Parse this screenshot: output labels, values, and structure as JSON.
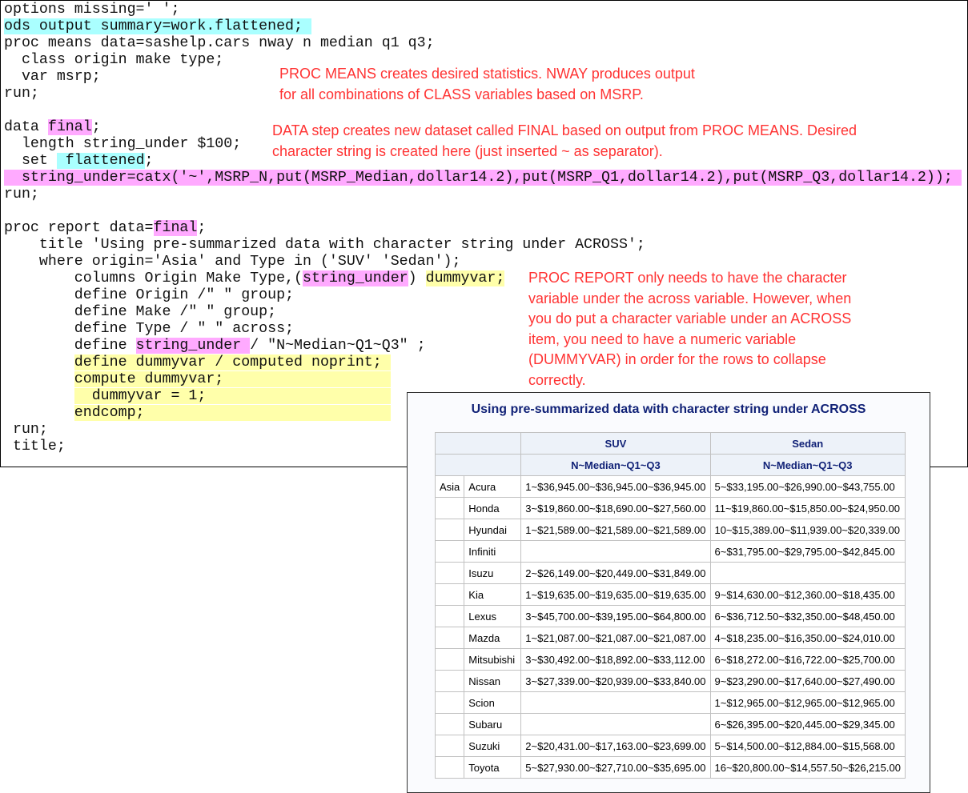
{
  "code_lines": [
    {
      "pre": "options missing=' ';",
      "hl": "",
      "post": ""
    },
    {
      "pre": "",
      "hl": "ods output summary=work.flattened; ",
      "post": "",
      "c": "hl-c"
    },
    {
      "pre": "proc means data=sashelp.cars nway n median q1 q3;",
      "hl": "",
      "post": ""
    },
    {
      "pre": "  class origin make type;",
      "hl": "",
      "post": ""
    },
    {
      "pre": "  var msrp;",
      "hl": "",
      "post": ""
    },
    {
      "pre": "run;",
      "hl": "",
      "post": ""
    },
    {
      "pre": "",
      "hl": "",
      "post": ""
    },
    {
      "pre": "data ",
      "hl": "final",
      "post": ";",
      "c": "hl-m"
    },
    {
      "pre": "  length string_under $100;",
      "hl": "",
      "post": ""
    },
    {
      "pre": "  set ",
      "hl": " flattened",
      "post": ";",
      "c": "hl-c"
    },
    {
      "pre": "",
      "hl": "  string_under=catx('~',MSRP_N,put(MSRP_Median,dollar14.2),put(MSRP_Q1,dollar14.2),put(MSRP_Q3,dollar14.2)); ",
      "post": "",
      "c": "hl-m"
    },
    {
      "pre": "run;",
      "hl": "",
      "post": ""
    },
    {
      "pre": "",
      "hl": "",
      "post": ""
    },
    {
      "pre": "proc report data=",
      "hl": "final",
      "post": ";",
      "c": "hl-m"
    },
    {
      "pre": "    title 'Using pre-summarized data with character string under ACROSS';",
      "hl": "",
      "post": ""
    },
    {
      "pre": "    where origin='Asia' and Type in ('SUV' 'Sedan');",
      "hl": "",
      "post": ""
    },
    {
      "pre": "        columns Origin Make Type,(",
      "hl": "string_under",
      "post": ") ",
      "c": "hl-m",
      "hl2": "dummyvar;"
    },
    {
      "pre": "        define Origin /\" \" group;",
      "hl": "",
      "post": ""
    },
    {
      "pre": "        define Make /\" \" group;",
      "hl": "",
      "post": ""
    },
    {
      "pre": "        define Type / \" \" across;",
      "hl": "",
      "post": ""
    },
    {
      "pre": "        define ",
      "hl": "string_under ",
      "post": "/ \"N~Median~Q1~Q3\" ;",
      "c": "hl-m"
    },
    {
      "pre": "        ",
      "hl": "define dummyvar / computed noprint; ",
      "post": "",
      "c": "hl-y"
    },
    {
      "pre": "        ",
      "hl": "compute dummyvar;                   ",
      "post": "",
      "c": "hl-y"
    },
    {
      "pre": "        ",
      "hl": "  dummyvar = 1;                     ",
      "post": "",
      "c": "hl-y"
    },
    {
      "pre": "        ",
      "hl": "endcomp;                            ",
      "post": "",
      "c": "hl-y"
    },
    {
      "pre": " run;",
      "hl": "",
      "post": ""
    },
    {
      "pre": " title;",
      "hl": "",
      "post": ""
    }
  ],
  "notes": {
    "means": [
      "PROC MEANS creates desired statistics. NWAY produces output",
      "for all combinations of CLASS variables based on MSRP."
    ],
    "data_step": [
      "DATA step creates new dataset called FINAL based on output from PROC MEANS. Desired",
      "character string is created here (just inserted ~ as separator)."
    ],
    "report": [
      "PROC REPORT only needs to have the character",
      "variable under the across variable. However, when",
      "you do put a character variable under an ACROSS",
      "item, you need to have a numeric variable",
      "(DUMMYVAR) in order for the rows to collapse",
      "correctly."
    ]
  },
  "report": {
    "title": "Using pre-summarized data with character string under ACROSS",
    "across": [
      "SUV",
      "Sedan"
    ],
    "sub_header": [
      "N~Median~Q1~Q3",
      "N~Median~Q1~Q3"
    ],
    "rows": [
      [
        "Asia",
        "Acura",
        "1~$36,945.00~$36,945.00~$36,945.00",
        "5~$33,195.00~$26,990.00~$43,755.00"
      ],
      [
        "",
        "Honda",
        "3~$19,860.00~$18,690.00~$27,560.00",
        "11~$19,860.00~$15,850.00~$24,950.00"
      ],
      [
        "",
        "Hyundai",
        "1~$21,589.00~$21,589.00~$21,589.00",
        "10~$15,389.00~$11,939.00~$20,339.00"
      ],
      [
        "",
        "Infiniti",
        "",
        "6~$31,795.00~$29,795.00~$42,845.00"
      ],
      [
        "",
        "Isuzu",
        "2~$26,149.00~$20,449.00~$31,849.00",
        ""
      ],
      [
        "",
        "Kia",
        "1~$19,635.00~$19,635.00~$19,635.00",
        "9~$14,630.00~$12,360.00~$18,435.00"
      ],
      [
        "",
        "Lexus",
        "3~$45,700.00~$39,195.00~$64,800.00",
        "6~$36,712.50~$32,350.00~$48,450.00"
      ],
      [
        "",
        "Mazda",
        "1~$21,087.00~$21,087.00~$21,087.00",
        "4~$18,235.00~$16,350.00~$24,010.00"
      ],
      [
        "",
        "Mitsubishi",
        "3~$30,492.00~$18,892.00~$33,112.00",
        "6~$18,272.00~$16,722.00~$25,700.00"
      ],
      [
        "",
        "Nissan",
        "3~$27,339.00~$20,939.00~$33,840.00",
        "9~$23,290.00~$17,640.00~$27,490.00"
      ],
      [
        "",
        "Scion",
        "",
        "1~$12,965.00~$12,965.00~$12,965.00"
      ],
      [
        "",
        "Subaru",
        "",
        "6~$26,395.00~$20,445.00~$29,345.00"
      ],
      [
        "",
        "Suzuki",
        "2~$20,431.00~$17,163.00~$23,699.00",
        "5~$14,500.00~$12,884.00~$15,568.00"
      ],
      [
        "",
        "Toyota",
        "5~$27,930.00~$27,710.00~$35,695.00",
        "16~$20,800.00~$14,557.50~$26,215.00"
      ]
    ]
  }
}
